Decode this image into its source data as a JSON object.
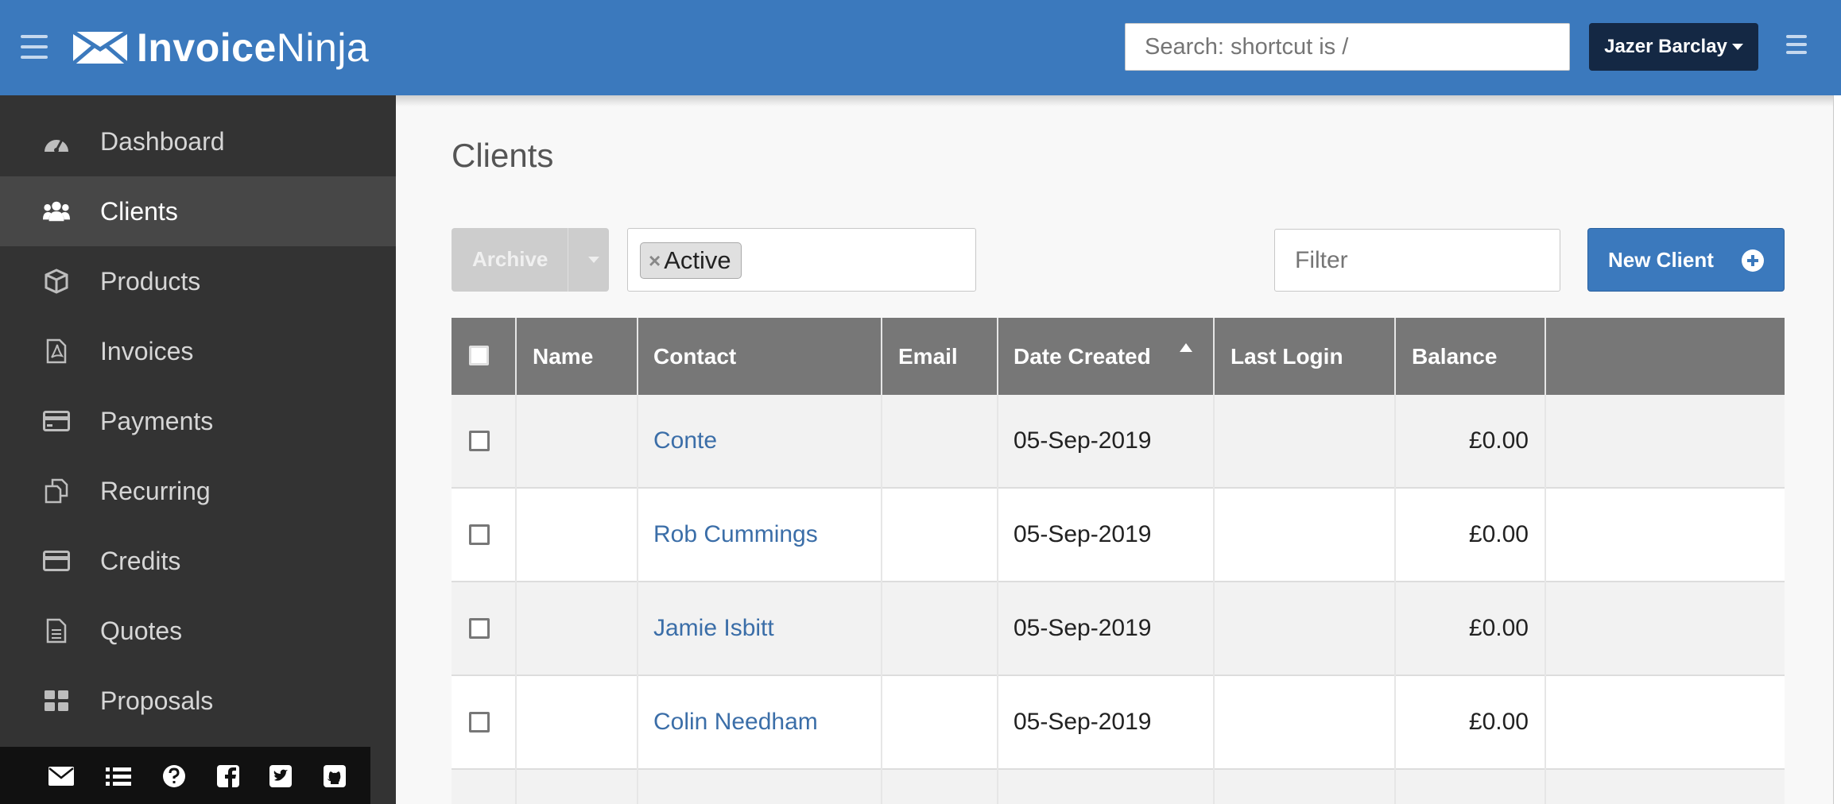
{
  "header": {
    "brand_bold": "Invoice",
    "brand_light": "Ninja",
    "search_placeholder": "Search: shortcut is /",
    "user_name": "Jazer Barclay"
  },
  "sidebar": {
    "items": [
      {
        "label": "Dashboard",
        "icon": "dashboard-icon"
      },
      {
        "label": "Clients",
        "icon": "users-icon",
        "active": true
      },
      {
        "label": "Products",
        "icon": "cube-icon"
      },
      {
        "label": "Invoices",
        "icon": "pdf-file-icon"
      },
      {
        "label": "Payments",
        "icon": "credit-card-icon"
      },
      {
        "label": "Recurring",
        "icon": "copy-icon"
      },
      {
        "label": "Credits",
        "icon": "credit-card-icon"
      },
      {
        "label": "Quotes",
        "icon": "file-text-icon"
      },
      {
        "label": "Proposals",
        "icon": "grid-icon"
      }
    ],
    "footer_icons": [
      "envelope-icon",
      "list-icon",
      "question-icon",
      "facebook-icon",
      "twitter-icon",
      "github-icon"
    ]
  },
  "main": {
    "title": "Clients",
    "archive_label": "Archive",
    "status_chip": "Active",
    "status_chip_remove": "×",
    "filter_placeholder": "Filter",
    "new_client_label": "New Client"
  },
  "table": {
    "columns": [
      "Name",
      "Contact",
      "Email",
      "Date Created",
      "Last Login",
      "Balance"
    ],
    "sorted_column": "Date Created",
    "sort_direction": "ascending",
    "rows": [
      {
        "name": "",
        "contact": "Conte",
        "email": "",
        "date_created": "05-Sep-2019",
        "last_login": "",
        "balance": "£0.00"
      },
      {
        "name": "",
        "contact": "Rob Cummings",
        "email": "",
        "date_created": "05-Sep-2019",
        "last_login": "",
        "balance": "£0.00"
      },
      {
        "name": "",
        "contact": "Jamie Isbitt",
        "email": "",
        "date_created": "05-Sep-2019",
        "last_login": "",
        "balance": "£0.00"
      },
      {
        "name": "",
        "contact": "Colin Needham",
        "email": "",
        "date_created": "05-Sep-2019",
        "last_login": "",
        "balance": "£0.00"
      }
    ]
  },
  "colors": {
    "brand_blue": "#3b79bd",
    "sidebar_bg": "#333333",
    "table_header": "#777777",
    "link": "#3b6ea8",
    "user_button": "#142844"
  }
}
